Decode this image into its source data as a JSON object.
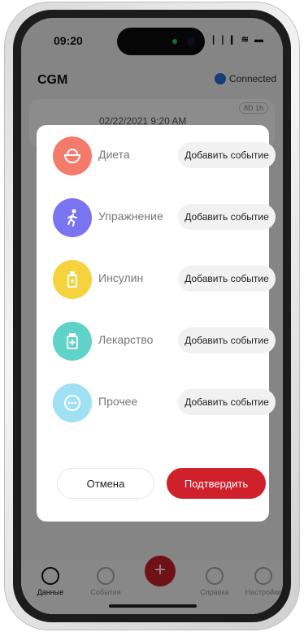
{
  "status_bar": {
    "time": "09:20",
    "icons": "❘❘❙ ≋ ▬"
  },
  "header": {
    "title": "CGM",
    "connection": "Connected"
  },
  "card": {
    "date": "02/22/2021 9:20 AM",
    "badge": "8D 1h"
  },
  "dialog": {
    "items": [
      {
        "label": "Диета",
        "button": "Добавить событие",
        "icon": "bowl-icon",
        "color": "#f47a6b"
      },
      {
        "label": "Упражнение",
        "button": "Добавить событие",
        "icon": "running-person-icon",
        "color": "#7b74f0"
      },
      {
        "label": "Инсулин",
        "button": "Добавить событие",
        "icon": "insulin-pen-icon",
        "color": "#f6d23c"
      },
      {
        "label": "Лекарство",
        "button": "Добавить событие",
        "icon": "medicine-bottle-icon",
        "color": "#5fd3c8"
      },
      {
        "label": "Прочее",
        "button": "Добавить событие",
        "icon": "more-icon",
        "color": "#9fe0f3"
      }
    ],
    "cancel": "Отмена",
    "confirm": "Подтвердить"
  },
  "tabbar": {
    "tabs": [
      {
        "label": "Данные",
        "icon": "data-icon"
      },
      {
        "label": "События",
        "icon": "events-icon"
      },
      {
        "label": "Справка",
        "icon": "heart-icon"
      },
      {
        "label": "Настройки",
        "icon": "settings-icon"
      }
    ],
    "fab": "+"
  },
  "colors": {
    "accent": "#d0202b",
    "dim_overlay": "rgba(0,0,0,0.45)"
  }
}
